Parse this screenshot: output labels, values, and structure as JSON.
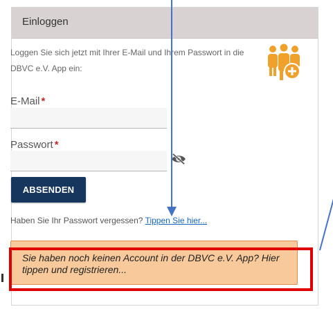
{
  "header": {
    "title": "Einloggen"
  },
  "intro": {
    "text": "Loggen Sie sich jetzt mit Ihrer E-Mail und Ihrem Passwort in die DBVC e.V. App ein:"
  },
  "form": {
    "email": {
      "label": "E-Mail",
      "required_mark": "*",
      "value": "",
      "placeholder": ""
    },
    "password": {
      "label": "Passwort",
      "required_mark": "*",
      "value": "",
      "placeholder": ""
    },
    "submit_label": "ABSENDEN"
  },
  "forgot": {
    "text": "Haben Sie Ihr Passwort vergessen?",
    "link_label": "Tippen Sie hier..."
  },
  "register": {
    "text": "Sie haben noch keinen Account in der DBVC e.V. App? Hier tippen und registrieren..."
  },
  "icons": {
    "users_icon": "users-add-icon",
    "eye_icon": "eye-slash-icon"
  },
  "colors": {
    "header_bg": "#d9d2d2",
    "button_bg": "#17365d",
    "accent_orange": "#f0a12b",
    "register_bg": "#f8c99a",
    "highlight_red": "#e00000",
    "annotation_blue": "#4472c4"
  }
}
